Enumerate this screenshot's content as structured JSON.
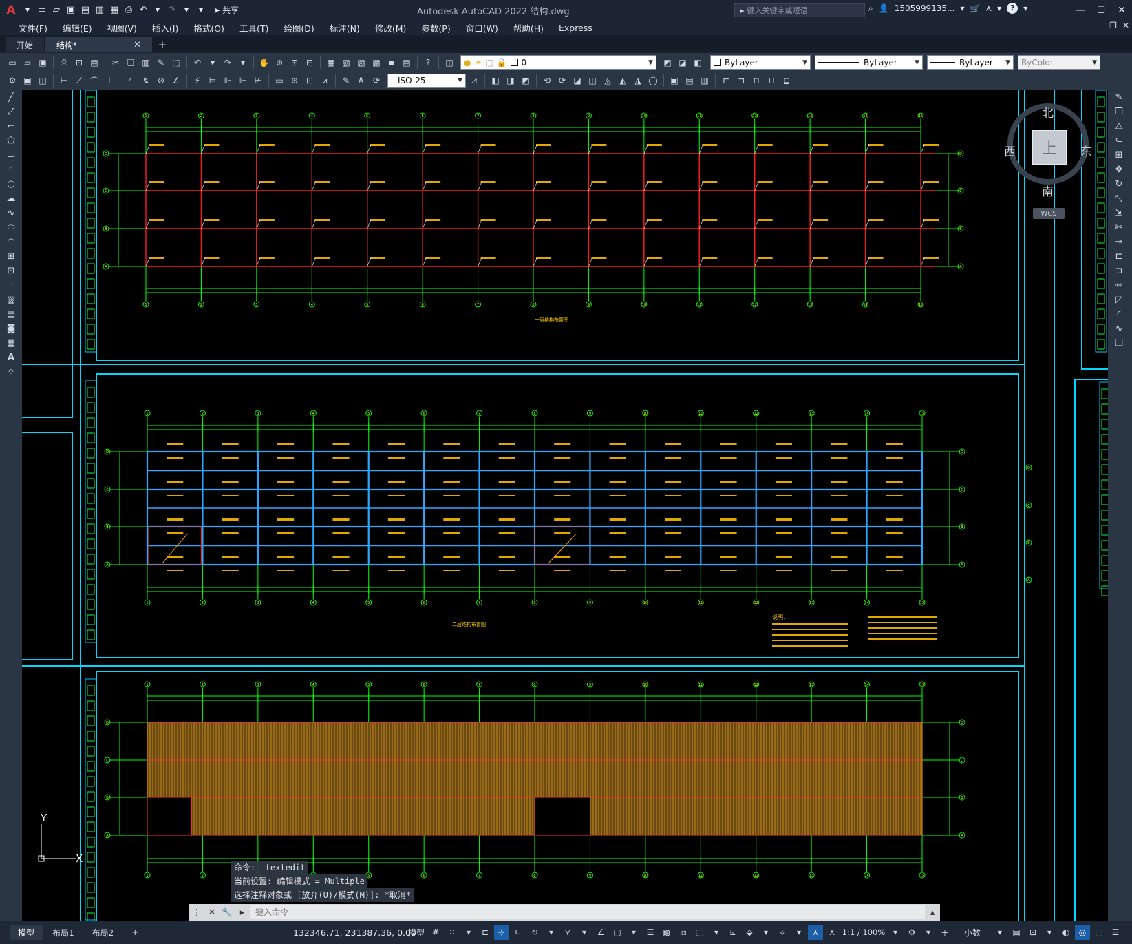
{
  "titlebar": {
    "app_letter": "A",
    "share_label": "共享",
    "title": "Autodesk AutoCAD 2022    结构.dwg",
    "search_placeholder": "键入关键字或短语",
    "user": "1505999135...",
    "icons": [
      "new-icon",
      "open-icon",
      "save-icon",
      "saveas-icon",
      "web-icon",
      "plot-icon",
      "print-icon",
      "undo-icon",
      "redo-icon",
      "share-icon"
    ]
  },
  "menu": [
    "文件(F)",
    "编辑(E)",
    "视图(V)",
    "插入(I)",
    "格式(O)",
    "工具(T)",
    "绘图(D)",
    "标注(N)",
    "修改(M)",
    "参数(P)",
    "窗口(W)",
    "帮助(H)",
    "Express"
  ],
  "tabs": [
    {
      "label": "开始",
      "active": false
    },
    {
      "label": "结构*",
      "active": true
    }
  ],
  "toolbar1": {
    "layer": "0",
    "color": "ByLayer",
    "linetype": "ByLayer",
    "lineweight": "ByLayer",
    "plotstyle": "ByColor"
  },
  "toolbar2": {
    "dimstyle": "ISO-25"
  },
  "drawing": {
    "grid_numbers": [
      "1",
      "2",
      "3",
      "4",
      "5",
      "6",
      "7",
      "8",
      "9",
      "10",
      "11",
      "12",
      "13",
      "14",
      "15"
    ],
    "grid_letters": [
      "A",
      "B",
      "C",
      "D"
    ],
    "plan1_title": "一层结构布置图",
    "plan2_title": "二层结构布置图",
    "notes_title": "说明："
  },
  "viewcube": {
    "north": "北",
    "south": "南",
    "east": "东",
    "west": "西",
    "top": "上",
    "wcs": "WCS"
  },
  "ucs": {
    "x": "X",
    "y": "Y"
  },
  "command": {
    "history": [
      "命令: _textedit",
      "当前设置: 编辑模式 = Multiple",
      "选择注释对象或 [放弃(U)/模式(M)]: *取消*"
    ],
    "placeholder": "键入命令"
  },
  "status": {
    "layouts": [
      "模型",
      "布局1",
      "布局2"
    ],
    "coords": "132346.71, 231387.36, 0.00",
    "space": "模型",
    "scale": "1:1 / 100%",
    "units": "小数"
  }
}
